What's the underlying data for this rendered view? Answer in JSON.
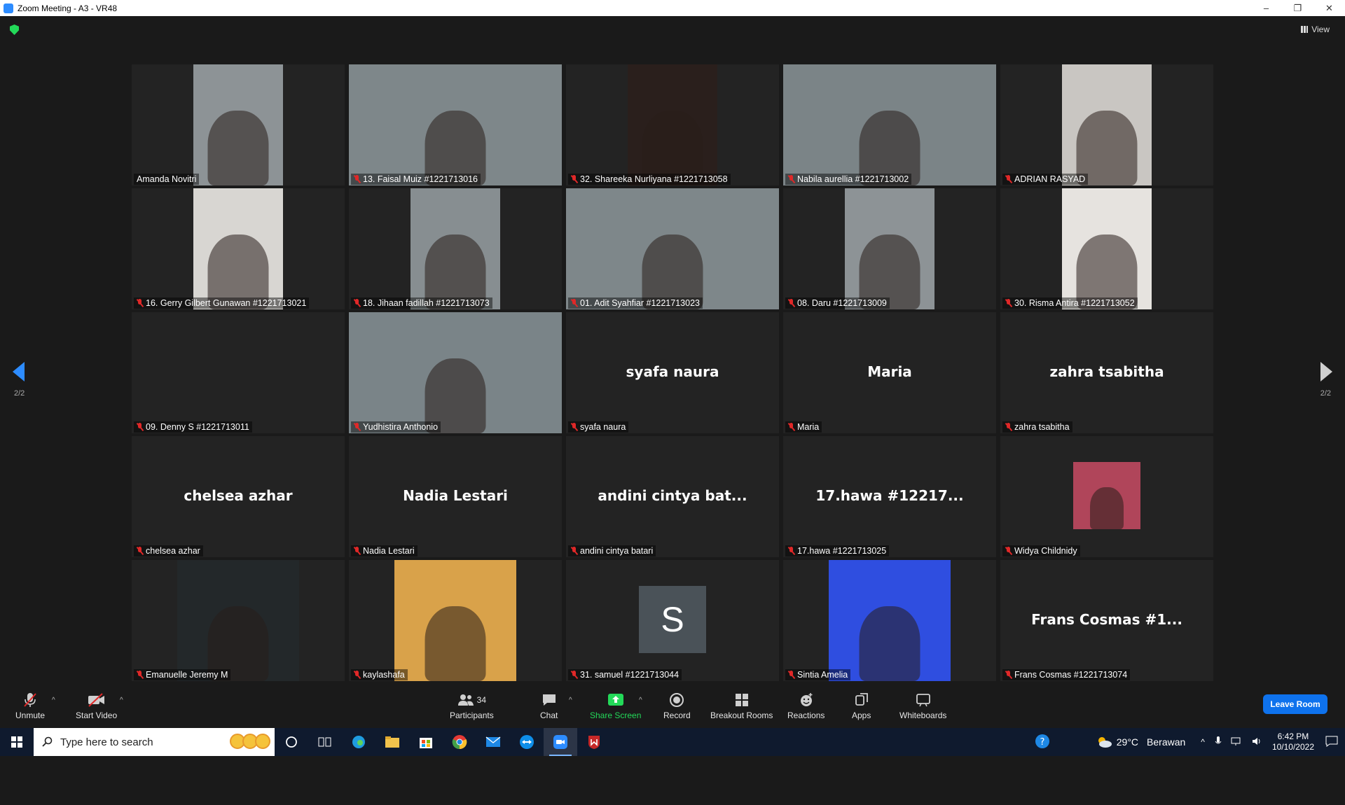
{
  "window": {
    "title": "Zoom Meeting - A3 - VR48"
  },
  "header": {
    "view_label": "View"
  },
  "gallery": {
    "page_left": "2/2",
    "page_right": "2/2",
    "tiles": [
      {
        "label": "Amanda Novitri",
        "muted": false,
        "type": "video",
        "bg": "#8d9396",
        "vleft": 88,
        "vwidth": 128
      },
      {
        "label": "13. Faisal Muiz #1221713016",
        "muted": true,
        "type": "video",
        "bg": "#7e878a",
        "vleft": 0,
        "vwidth": 304
      },
      {
        "label": "32. Shareeka Nurliyana #1221713058",
        "muted": true,
        "type": "video",
        "bg": "#2a1f1c",
        "vleft": 88,
        "vwidth": 128
      },
      {
        "label": "Nabila aurellia #1221713002",
        "muted": true,
        "type": "video",
        "bg": "#7b8487",
        "vleft": 0,
        "vwidth": 304
      },
      {
        "label": "ADRIAN RASYAD",
        "muted": true,
        "type": "video",
        "bg": "#c9c6c2",
        "vleft": 88,
        "vwidth": 128
      },
      {
        "label": "16. Gerry Gilbert Gunawan #1221713021",
        "muted": true,
        "type": "video",
        "bg": "#d8d6d2",
        "vleft": 88,
        "vwidth": 128
      },
      {
        "label": "18. Jihaan fadillah #1221713073",
        "muted": true,
        "type": "video",
        "bg": "#878e91",
        "vleft": 88,
        "vwidth": 128
      },
      {
        "label": "01. Adit Syahfiar #1221713023",
        "muted": true,
        "type": "video",
        "bg": "#7e878a",
        "vleft": 0,
        "vwidth": 304
      },
      {
        "label": "08. Daru #1221713009",
        "muted": true,
        "type": "video",
        "bg": "#8d9396",
        "vleft": 88,
        "vwidth": 128
      },
      {
        "label": "30. Risma Antira #1221713052",
        "muted": true,
        "type": "video",
        "bg": "#e6e3df",
        "vleft": 88,
        "vwidth": 128
      },
      {
        "label": "09. Denny S #1221713011",
        "muted": true,
        "type": "blank"
      },
      {
        "label": "Yudhistira Anthonio",
        "muted": true,
        "type": "video",
        "bg": "#7a8488",
        "vleft": 0,
        "vwidth": 304
      },
      {
        "label": "syafa naura",
        "muted": true,
        "type": "name",
        "display": "syafa naura"
      },
      {
        "label": "Maria",
        "muted": true,
        "type": "name",
        "display": "Maria"
      },
      {
        "label": "zahra tsabitha",
        "muted": true,
        "type": "name",
        "display": "zahra tsabitha"
      },
      {
        "label": "chelsea azhar",
        "muted": true,
        "type": "name",
        "display": "chelsea azhar"
      },
      {
        "label": "Nadia Lestari",
        "muted": true,
        "type": "name",
        "display": "Nadia Lestari"
      },
      {
        "label": "andini cintya batari",
        "muted": true,
        "type": "name",
        "display": "andini cintya bat..."
      },
      {
        "label": "17.hawa #1221713025",
        "muted": true,
        "type": "name",
        "display": "17.hawa #12217..."
      },
      {
        "label": "Widya Childnidy",
        "muted": true,
        "type": "photo",
        "bg": "#b0455a",
        "vleft": 104,
        "vtop": 37,
        "vwidth": 96,
        "vheight": 96
      },
      {
        "label": "Emanuelle Jeremy M",
        "muted": true,
        "type": "video",
        "bg": "#23282a",
        "vleft": 65,
        "vwidth": 174
      },
      {
        "label": "kaylashafa",
        "muted": true,
        "type": "video",
        "bg": "#d9a24a",
        "vleft": 65,
        "vwidth": 174
      },
      {
        "label": "31. samuel #1221713044",
        "muted": true,
        "type": "avatar",
        "initial": "S"
      },
      {
        "label": "Sintia Amelia",
        "muted": true,
        "type": "video",
        "bg": "#2f4ee0",
        "vleft": 65,
        "vwidth": 174
      },
      {
        "label": "Frans Cosmas #1221713074",
        "muted": true,
        "type": "name",
        "display": "Frans Cosmas #1..."
      }
    ]
  },
  "toolbar": {
    "unmute": "Unmute",
    "start_video": "Start Video",
    "participants": "Participants",
    "participants_count": "34",
    "chat": "Chat",
    "share_screen": "Share Screen",
    "record": "Record",
    "breakout_rooms": "Breakout Rooms",
    "reactions": "Reactions",
    "apps": "Apps",
    "whiteboards": "Whiteboards",
    "leave": "Leave Room",
    "share_color": "#23d959",
    "leave_color": "#0e72ed"
  },
  "taskbar": {
    "search_placeholder": "Type here to search",
    "weather_temp": "29°C",
    "weather_desc": "Berawan",
    "time": "6:42 PM",
    "date": "10/10/2022"
  }
}
